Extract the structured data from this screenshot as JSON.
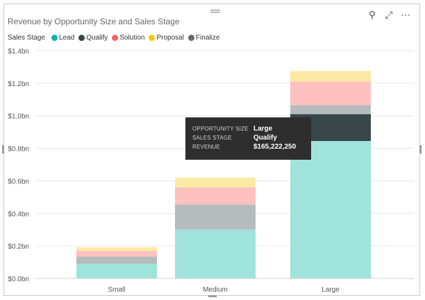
{
  "title": "Revenue by Opportunity Size and Sales Stage",
  "toolbar": [
    {
      "name": "pin-icon",
      "glyph": "⚲"
    },
    {
      "name": "focus-mode-icon",
      "glyph": "⤢"
    },
    {
      "name": "more-options-icon",
      "glyph": "⋯"
    }
  ],
  "legend": {
    "title": "Sales Stage",
    "items": [
      {
        "label": "Lead",
        "color": "#01b8aa"
      },
      {
        "label": "Qualify",
        "color": "#374649"
      },
      {
        "label": "Solution",
        "color": "#fd625e"
      },
      {
        "label": "Proposal",
        "color": "#f2c80f"
      },
      {
        "label": "Finalize",
        "color": "#5f6b6d"
      }
    ]
  },
  "chart_data": {
    "type": "bar",
    "stacked": true,
    "title": "Revenue by Opportunity Size and Sales Stage",
    "xlabel": "",
    "ylabel": "",
    "categories": [
      "Small",
      "Medium",
      "Large"
    ],
    "ylim": [
      0,
      1400000000
    ],
    "yticks": [
      "$0.0bn",
      "$0.2bn",
      "$0.4bn",
      "$0.6bn",
      "$0.8bn",
      "$1.0bn",
      "$1.2bn",
      "$1.4bn"
    ],
    "grid": true,
    "legend_position": "top-left",
    "highlight": {
      "category": "Large",
      "series": "Qualify"
    },
    "series": [
      {
        "name": "Lead",
        "color": "#01b8aa",
        "values": [
          90000000,
          300000000,
          845000000
        ]
      },
      {
        "name": "Qualify",
        "color": "#374649",
        "values": [
          0,
          0,
          165222250
        ]
      },
      {
        "name": "Solution",
        "color": "#fd625e",
        "values": [
          35000000,
          105000000,
          145000000
        ]
      },
      {
        "name": "Proposal",
        "color": "#f2c80f",
        "values": [
          22000000,
          60000000,
          65000000
        ]
      },
      {
        "name": "Finalize",
        "color": "#5f6b6d",
        "values": [
          45000000,
          155000000,
          55000000
        ]
      }
    ],
    "order_bottom_to_top": [
      "Lead",
      "Qualify",
      "Finalize",
      "Solution",
      "Proposal",
      "Finalize_top"
    ]
  },
  "tooltip": {
    "rows": [
      {
        "key": "OPPORTUNITY SIZE",
        "value": "Large"
      },
      {
        "key": "SALES STAGE",
        "value": "Qualify"
      },
      {
        "key": "REVENUE",
        "value": "$165,222,250"
      }
    ]
  }
}
